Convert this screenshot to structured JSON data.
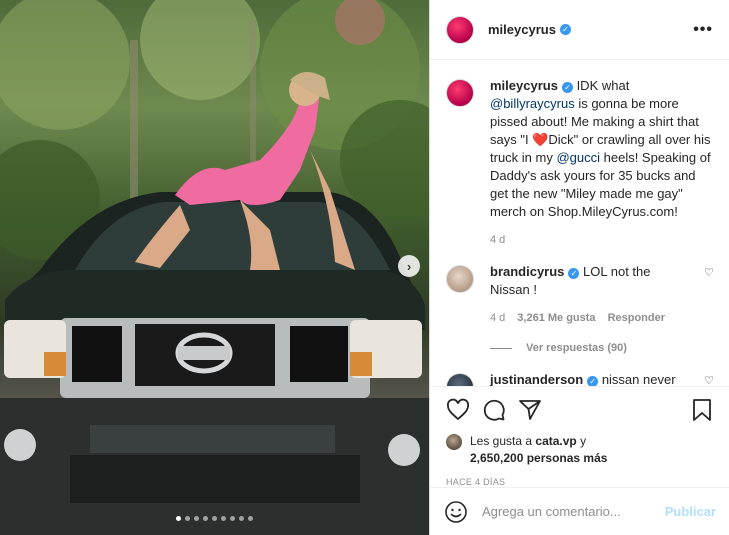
{
  "post": {
    "username": "mileycyrus",
    "more_label": "•••"
  },
  "caption": {
    "username": "mileycyrus",
    "parts": {
      "t1": "IDK what ",
      "mention1": "@billyraycyrus",
      "t2": " is gonna be more pissed about! Me making a shirt that says \"I ",
      "heart": "❤️",
      "t3": "Dick\" or crawling all over his truck in my ",
      "mention2": "@gucci",
      "t4": " heels! Speaking of Daddy's ask yours for 35 bucks and get the new \"Miley made me gay\" merch on Shop.MileyCyrus.com!"
    },
    "time": "4 d"
  },
  "comments": [
    {
      "username": "brandicyrus",
      "text": "LOL not the Nissan !",
      "time": "4 d",
      "likes": "3,261 Me gusta",
      "reply": "Responder",
      "view_replies": "Ver respuestas (90)"
    },
    {
      "username": "justinanderson",
      "text": "nissan never"
    }
  ],
  "likes": {
    "prefix": "Les gusta a ",
    "user": "cata.vp",
    "middle": " y",
    "count": "2,650,200 personas más"
  },
  "timestamp": "HACE 4 DÍAS",
  "add_comment": {
    "placeholder": "Agrega un comentario...",
    "publish": "Publicar"
  },
  "carousel": {
    "next_icon": "›",
    "dot_count": 9,
    "active_index": 0
  },
  "colors": {
    "verified": "#3897f0",
    "link": "#00376b",
    "publish_disabled": "#b2dffc"
  }
}
